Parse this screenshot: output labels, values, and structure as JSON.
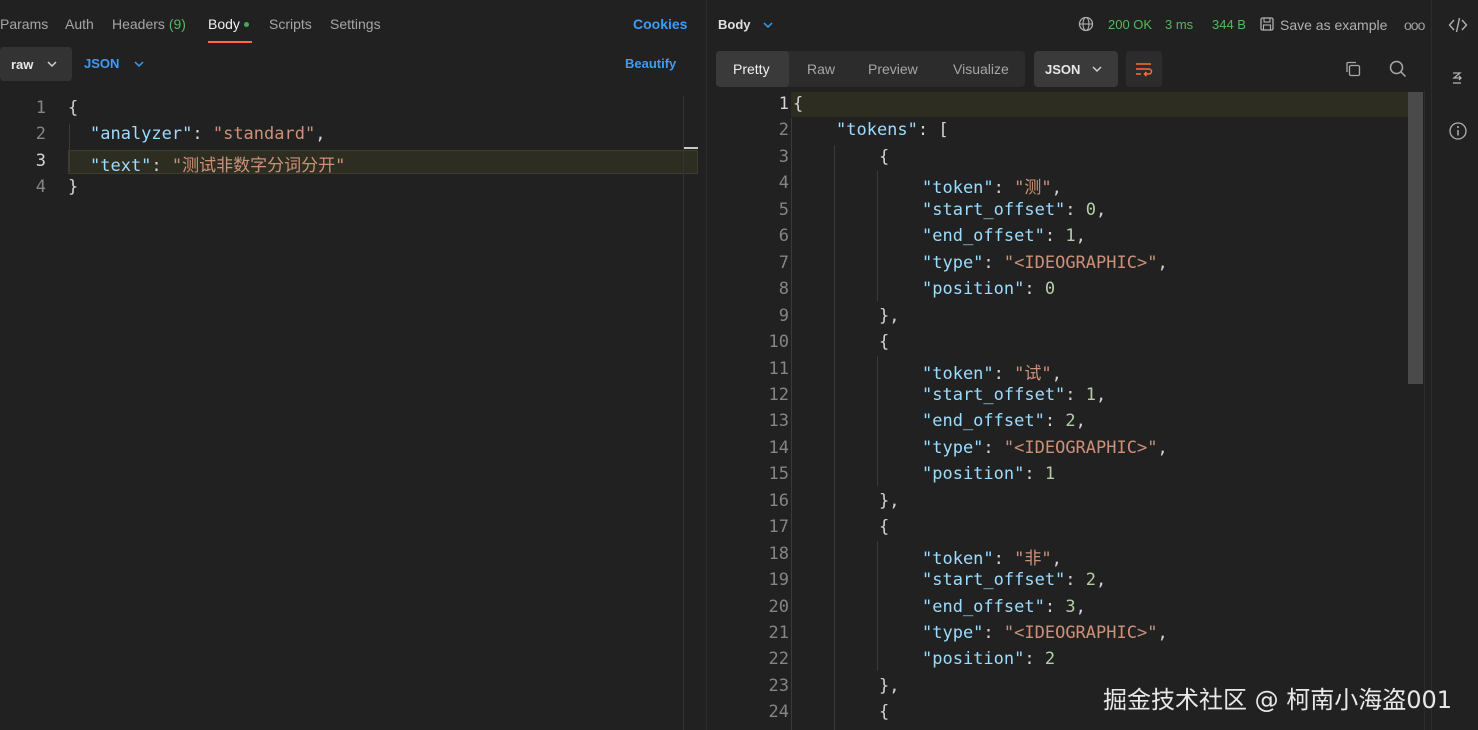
{
  "request": {
    "tabs": [
      {
        "label": "Params"
      },
      {
        "label": "Auth"
      },
      {
        "label": "Headers",
        "count": "(9)"
      },
      {
        "label": "Body"
      },
      {
        "label": "Scripts"
      },
      {
        "label": "Settings"
      }
    ],
    "cookies_label": "Cookies",
    "body_mode": "raw",
    "body_format": "JSON",
    "beautify_label": "Beautify",
    "line_numbers": [
      "1",
      "2",
      "3",
      "4"
    ],
    "lines": [
      {
        "open": "{"
      },
      {
        "key": "\"analyzer\"",
        "colon": ": ",
        "value": "\"standard\"",
        "tail": ","
      },
      {
        "key": "\"text\"",
        "colon": ": ",
        "value": "\"测试非数字分词分开\"",
        "tail": ""
      },
      {
        "close": "}"
      }
    ]
  },
  "response": {
    "section_label": "Body",
    "status": "200 OK",
    "time": "3 ms",
    "size": "344 B",
    "save_label": "Save as example",
    "more_label": "ooo",
    "view_tabs": [
      "Pretty",
      "Raw",
      "Preview",
      "Visualize"
    ],
    "format": "JSON",
    "line_numbers": [
      "1",
      "2",
      "3",
      "4",
      "5",
      "6",
      "7",
      "8",
      "9",
      "10",
      "11",
      "12",
      "13",
      "14",
      "15",
      "16",
      "17",
      "18",
      "19",
      "20",
      "21",
      "22",
      "23",
      "24"
    ],
    "tokens": [
      {
        "token": "\"测\"",
        "start_offset": "0",
        "end_offset": "1",
        "type": "\"<IDEOGRAPHIC>\"",
        "position": "0"
      },
      {
        "token": "\"试\"",
        "start_offset": "1",
        "end_offset": "2",
        "type": "\"<IDEOGRAPHIC>\"",
        "position": "1"
      },
      {
        "token": "\"非\"",
        "start_offset": "2",
        "end_offset": "3",
        "type": "\"<IDEOGRAPHIC>\"",
        "position": "2"
      }
    ],
    "keys": {
      "tokens": "\"tokens\"",
      "token": "\"token\"",
      "start_offset": "\"start_offset\"",
      "end_offset": "\"end_offset\"",
      "type": "\"type\"",
      "position": "\"position\""
    }
  },
  "watermark": "掘金技术社区 @ 柯南小海盗001",
  "colors": {
    "accent_orange": "#ff6c37",
    "link_blue": "#3e9cf5",
    "status_green": "#55b85e",
    "json_key": "#9cdcfe",
    "json_string": "#ce9178",
    "json_number": "#b5cea8"
  }
}
